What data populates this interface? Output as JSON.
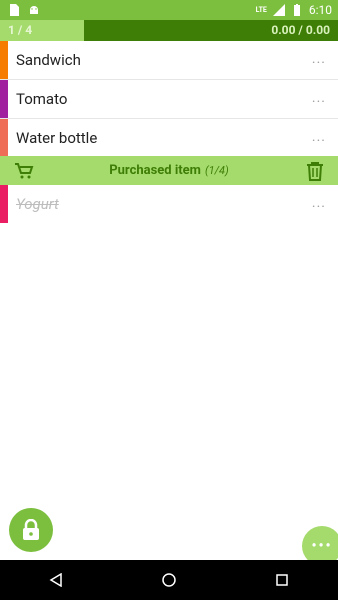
{
  "status_bar": {
    "time": "6:10",
    "network": "LTE",
    "icons": [
      "sim-card-icon",
      "android-icon",
      "signal-icon",
      "battery-icon"
    ]
  },
  "progress": {
    "count": "1 / 4",
    "total": "0.00 / 0.00",
    "fraction": 0.25
  },
  "items": [
    {
      "name": "Sandwich",
      "color": "#f57c00",
      "more": "..."
    },
    {
      "name": "Tomato",
      "color": "#a020a0",
      "more": "..."
    },
    {
      "name": "Water bottle",
      "color": "#ef6c57",
      "more": "..."
    }
  ],
  "purchased_section": {
    "title": "Purchased item",
    "count": "(1/4)",
    "icons": [
      "cart-icon",
      "trash-icon"
    ]
  },
  "purchased_items": [
    {
      "name": "Yogurt",
      "color": "#e91e63",
      "more": "..."
    }
  ],
  "fab": {
    "lock_icon": "lock-icon",
    "more_label": "•••"
  },
  "nav": [
    "back-icon",
    "home-icon",
    "recents-icon"
  ],
  "colors": {
    "primary": "#7cbf3e",
    "light": "#a4db6c",
    "dark": "#3f7e06"
  }
}
